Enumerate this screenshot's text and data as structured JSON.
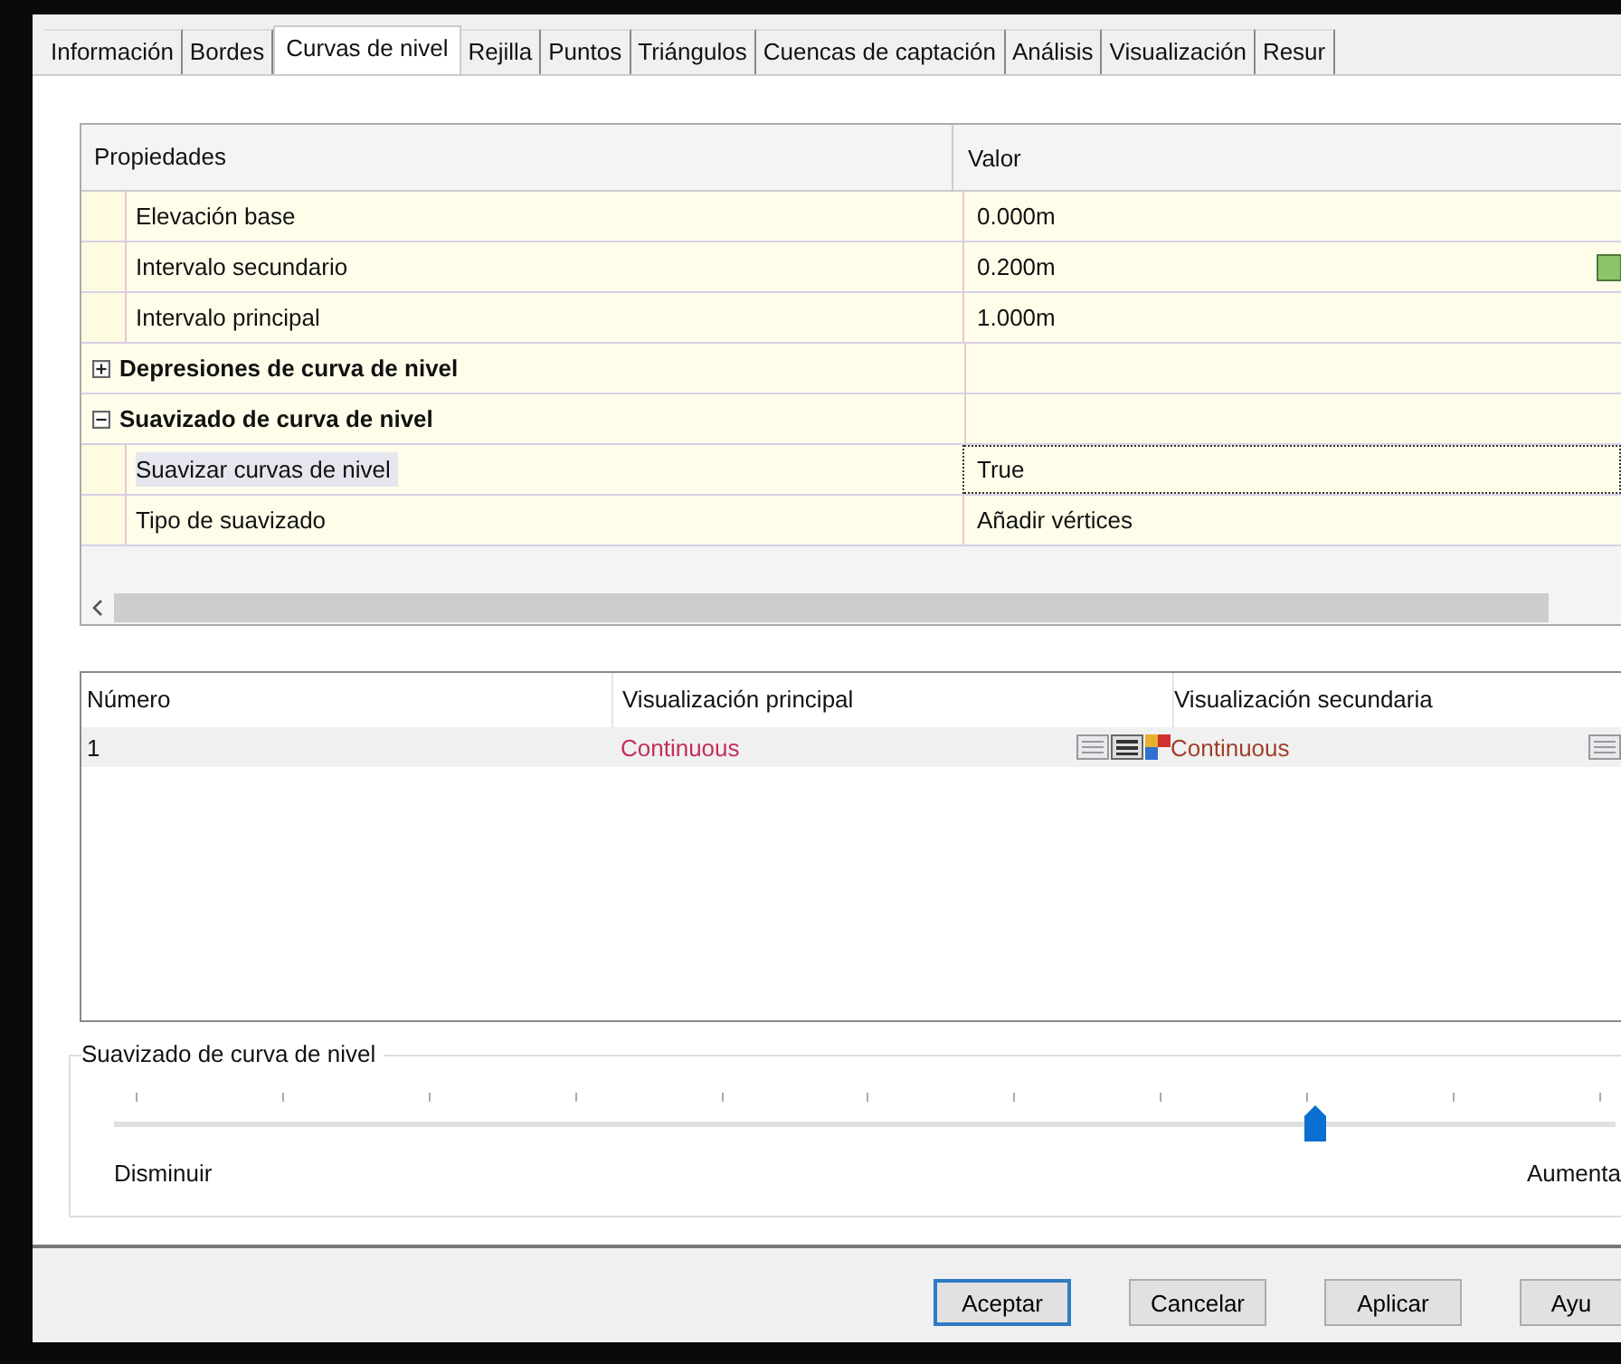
{
  "tabs": [
    {
      "label": "Información",
      "selected": false
    },
    {
      "label": "Bordes",
      "selected": false
    },
    {
      "label": "Curvas de nivel",
      "selected": true
    },
    {
      "label": "Rejilla",
      "selected": false
    },
    {
      "label": "Puntos",
      "selected": false
    },
    {
      "label": "Triángulos",
      "selected": false
    },
    {
      "label": "Cuencas de captación",
      "selected": false
    },
    {
      "label": "Análisis",
      "selected": false
    },
    {
      "label": "Visualización",
      "selected": false
    },
    {
      "label": "Resur",
      "selected": false
    }
  ],
  "property_grid": {
    "columns": [
      "Propiedades",
      "Valor"
    ],
    "rows": [
      {
        "kind": "property",
        "name": "Elevación base",
        "value": "0.000m",
        "selected": false
      },
      {
        "kind": "property",
        "name": "Intervalo secundario",
        "value": "0.200m",
        "selected": false,
        "has_button": true
      },
      {
        "kind": "property",
        "name": "Intervalo principal",
        "value": "1.000m",
        "selected": false
      },
      {
        "kind": "category",
        "name": "Depresiones de curva de nivel",
        "expanded": false
      },
      {
        "kind": "category",
        "name": "Suavizado de curva de nivel",
        "expanded": true
      },
      {
        "kind": "property",
        "name": "Suavizar curvas de nivel",
        "value": "True",
        "selected": true
      },
      {
        "kind": "property",
        "name": "Tipo de suavizado",
        "value": "Añadir vértices",
        "selected": false
      }
    ]
  },
  "contour_list": {
    "columns": [
      "Número",
      "Visualización principal",
      "Visualización secundaria"
    ],
    "rows": [
      {
        "number": "1",
        "principal": "Continuous",
        "secundaria": "Continuous"
      }
    ]
  },
  "smoothing": {
    "title": "Suavizado de curva de nivel",
    "level": 0.8,
    "min_label": "Disminuir",
    "max_label": "Aumenta"
  },
  "buttons": [
    {
      "label": "Aceptar",
      "default": true
    },
    {
      "label": "Cancelar",
      "default": false
    },
    {
      "label": "Aplicar",
      "default": false
    },
    {
      "label": "Ayu",
      "default": false
    }
  ]
}
